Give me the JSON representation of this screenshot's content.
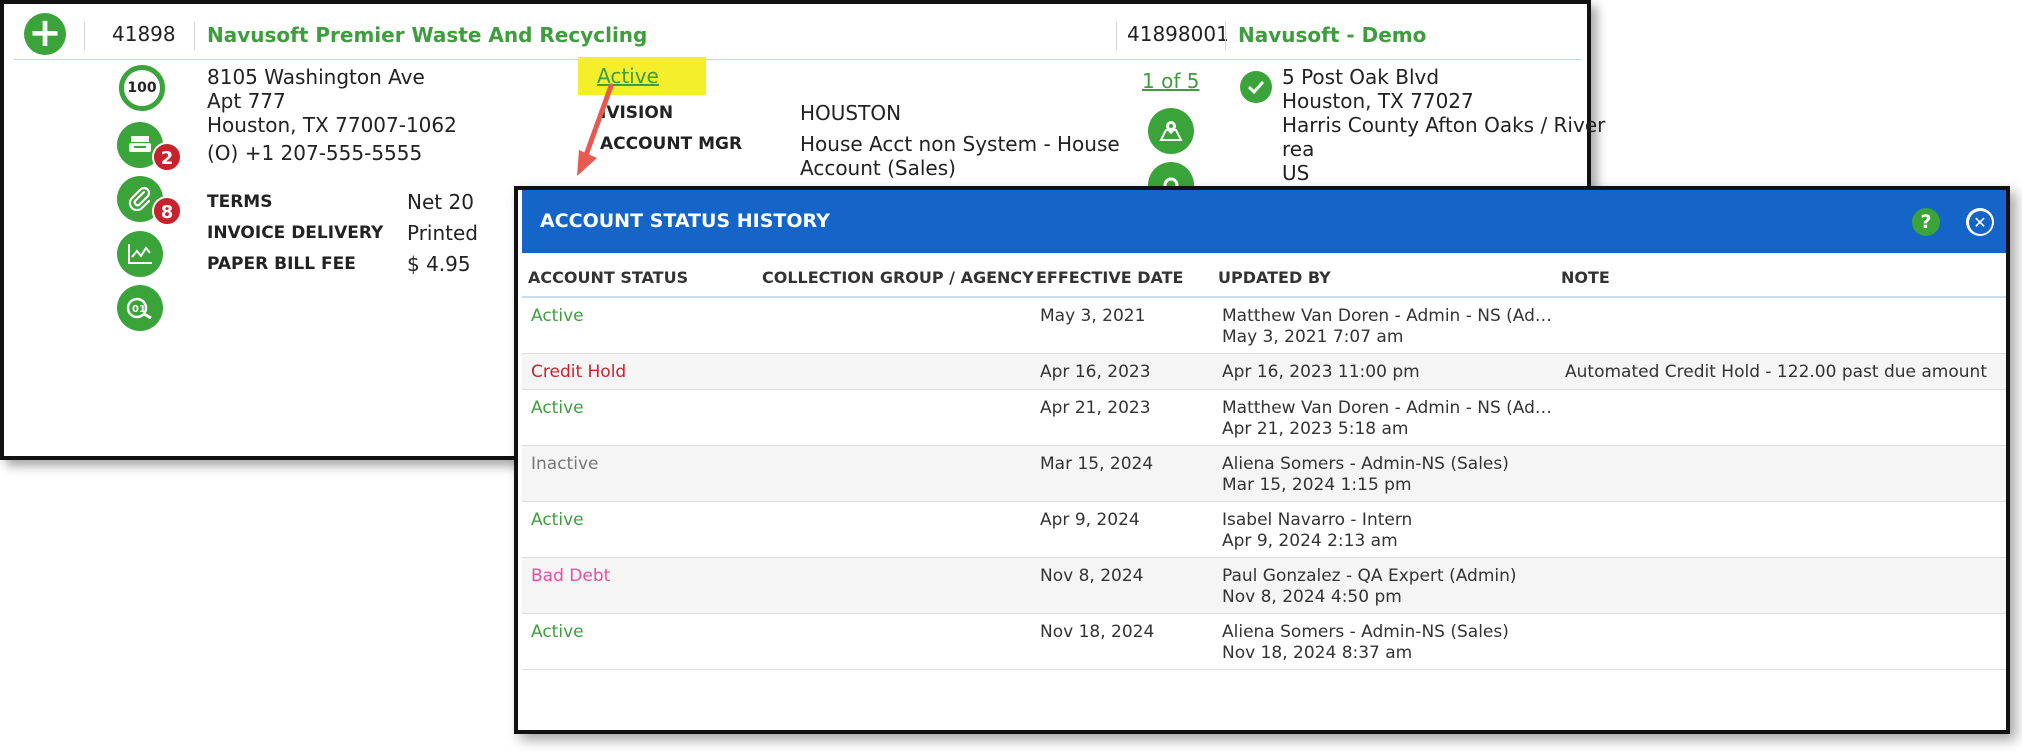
{
  "account": {
    "id": "41898",
    "name": "Navusoft Premier Waste And Recycling",
    "site_id": "41898001",
    "site_name": "Navusoft - Demo",
    "score": "100",
    "address": {
      "line1": "8105 Washington Ave",
      "line2": "Apt 777",
      "line3": "Houston, TX 77007-1062",
      "phone": "(O) +1 207-555-5555"
    },
    "badges": {
      "billing_count": "2",
      "attachments_count": "8"
    },
    "terms": [
      {
        "label": "TERMS",
        "value": "Net 20"
      },
      {
        "label": "INVOICE DELIVERY",
        "value": "Printed"
      },
      {
        "label": "PAPER BILL FEE",
        "value": "$ 4.95"
      }
    ],
    "status": "Active",
    "division_label": "DIVISION",
    "division_value": "HOUSTON",
    "division_label_visible": "IVISION",
    "account_mgr_label": "ACCOUNT MGR",
    "account_mgr_value_1": "House Acct non System - House",
    "account_mgr_value_2": "Account (Sales)",
    "site_pager": "1 of 5",
    "site_address": {
      "line1": "5 Post Oak Blvd",
      "line2": "Houston, TX 77027",
      "line3": "Harris County Afton Oaks / River",
      "line4": "rea",
      "line5": "US"
    }
  },
  "modal": {
    "title": "ACCOUNT STATUS HISTORY",
    "help_label": "?",
    "close_label": "✕",
    "columns": [
      "ACCOUNT STATUS",
      "COLLECTION GROUP / AGENCY",
      "EFFECTIVE DATE",
      "UPDATED BY",
      "NOTE"
    ],
    "rows": [
      {
        "status": "Active",
        "group": "",
        "date": "May 3, 2021",
        "updated_by": "Matthew Van Doren - Admin - NS (Ad…",
        "updated_at": "May 3, 2021 7:07 am",
        "note": ""
      },
      {
        "status": "Credit Hold",
        "group": "",
        "date": "Apr 16, 2023",
        "updated_by": "Apr 16, 2023 11:00 pm",
        "updated_at": "",
        "note": "Automated Credit Hold - 122.00 past due amount"
      },
      {
        "status": "Active",
        "group": "",
        "date": "Apr 21, 2023",
        "updated_by": "Matthew Van Doren - Admin - NS (Ad…",
        "updated_at": "Apr 21, 2023 5:18 am",
        "note": ""
      },
      {
        "status": "Inactive",
        "group": "",
        "date": "Mar 15, 2024",
        "updated_by": "Aliena Somers - Admin-NS (Sales)",
        "updated_at": "Mar 15, 2024 1:15 pm",
        "note": ""
      },
      {
        "status": "Active",
        "group": "",
        "date": "Apr 9, 2024",
        "updated_by": "Isabel Navarro - Intern",
        "updated_at": "Apr 9, 2024 2:13 am",
        "note": ""
      },
      {
        "status": "Bad Debt",
        "group": "",
        "date": "Nov 8, 2024",
        "updated_by": "Paul Gonzalez - QA Expert (Admin)",
        "updated_at": "Nov 8, 2024 4:50 pm",
        "note": ""
      },
      {
        "status": "Active",
        "group": "",
        "date": "Nov 18, 2024",
        "updated_by": "Aliena Somers - Admin-NS (Sales)",
        "updated_at": "Nov 18, 2024 8:37 am",
        "note": ""
      }
    ]
  },
  "colors": {
    "accent_green": "#3f9c3f",
    "modal_blue": "#1565c8",
    "credit_hold_red": "#c8232c",
    "bad_debt_pink": "#e54fa5",
    "highlight_yellow": "#f5ee2b",
    "arrow_red": "#e85a4f"
  },
  "icons": [
    "plus-circle-icon",
    "score-ring-icon",
    "billing-icon",
    "paperclip-icon",
    "chart-icon",
    "search-icon",
    "map-pin-icon",
    "check-circle-icon",
    "help-icon",
    "close-icon",
    "annotation-arrow-icon"
  ]
}
